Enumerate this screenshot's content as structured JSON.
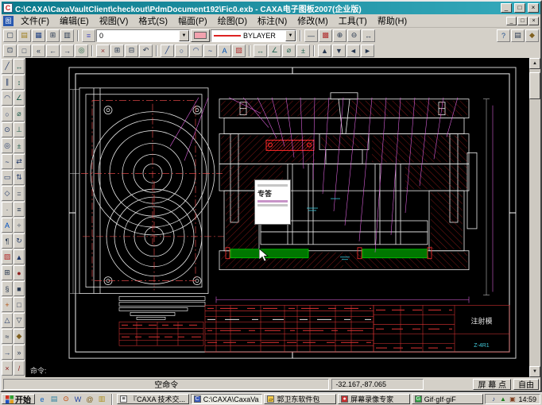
{
  "glyphs": {
    "arrow_down": "▼",
    "arrow_up": "▲"
  },
  "titlebar": {
    "title": "C:\\CAXA\\CaxaVaultClient\\checkout\\PdmDocument192\\Fic0.exb - CAXA电子图板2007(企业版)",
    "app_icon_glyph": "C",
    "min_glyph": "_",
    "max_glyph": "□",
    "close_glyph": "×"
  },
  "menubar": {
    "child_icon_glyph": "图",
    "items": [
      {
        "name": "menu-file",
        "label": "文件(F)"
      },
      {
        "name": "menu-edit",
        "label": "编辑(E)"
      },
      {
        "name": "menu-view",
        "label": "视图(V)"
      },
      {
        "name": "menu-format",
        "label": "格式(S)"
      },
      {
        "name": "menu-sheet",
        "label": "幅面(P)"
      },
      {
        "name": "menu-draw",
        "label": "绘图(D)"
      },
      {
        "name": "menu-dimension",
        "label": "标注(N)"
      },
      {
        "name": "menu-modify",
        "label": "修改(M)"
      },
      {
        "name": "menu-tools",
        "label": "工具(T)"
      },
      {
        "name": "menu-help",
        "label": "帮助(H)"
      }
    ],
    "child_min": "_",
    "child_restore": "□",
    "child_close": "×"
  },
  "toolbar1": {
    "file_group": [
      {
        "name": "new-file-icon",
        "glyph": "▢"
      },
      {
        "name": "open-file-icon",
        "glyph": "▤",
        "color": "#a08020"
      },
      {
        "name": "save-file-icon",
        "glyph": "▦",
        "color": "#204080"
      },
      {
        "name": "print-icon",
        "glyph": "⊞"
      },
      {
        "name": "preview-icon",
        "glyph": "▥"
      }
    ],
    "layers_icon": {
      "glyph": "≡",
      "color": "#5050c0"
    },
    "layer_value": "0",
    "color_value": "#f2a2ae",
    "linetype_value": "BYLAYER",
    "linetype_color": "#dd2222",
    "mid_group": [
      {
        "name": "linewidth-icon",
        "glyph": "—"
      },
      {
        "name": "color-palette-icon",
        "glyph": "▩",
        "color": "#b03030"
      },
      {
        "name": "zoom-in-icon",
        "glyph": "⊕"
      },
      {
        "name": "zoom-out-icon",
        "glyph": "⊖"
      },
      {
        "name": "pan-icon",
        "glyph": "↔"
      }
    ],
    "right_group": [
      {
        "name": "help-icon",
        "glyph": "?",
        "color": "#205090"
      },
      {
        "name": "properties-icon",
        "glyph": "▤"
      },
      {
        "name": "options-icon",
        "glyph": "◆",
        "color": "#806020"
      }
    ]
  },
  "toolbar2": {
    "g1": [
      {
        "name": "zoom-window-icon",
        "glyph": "⊡"
      },
      {
        "name": "zoom-all-icon",
        "glyph": "□"
      },
      {
        "name": "zoom-prev-icon",
        "glyph": "«"
      },
      {
        "name": "pan-left-icon",
        "glyph": "←"
      },
      {
        "name": "pan-right-icon",
        "glyph": "→"
      },
      {
        "name": "refresh-icon",
        "glyph": "◎",
        "color": "#206040"
      }
    ],
    "g2": [
      {
        "name": "cut-icon",
        "glyph": "×",
        "color": "#903030"
      },
      {
        "name": "copy-icon",
        "glyph": "⊞"
      },
      {
        "name": "paste-icon",
        "glyph": "⊟"
      },
      {
        "name": "undo-icon",
        "glyph": "↶"
      }
    ],
    "g3": [
      {
        "name": "draw-line-icon",
        "glyph": "╱",
        "color": "#204080"
      },
      {
        "name": "draw-circle-icon",
        "glyph": "○",
        "color": "#204080"
      },
      {
        "name": "draw-arc-icon",
        "glyph": "◠",
        "color": "#204080"
      },
      {
        "name": "draw-spline-icon",
        "glyph": "~",
        "color": "#204080"
      },
      {
        "name": "draw-text-icon",
        "glyph": "A",
        "color": "#0050b0"
      },
      {
        "name": "draw-hatch-icon",
        "glyph": "▨",
        "color": "#b03030"
      }
    ],
    "g4": [
      {
        "name": "dim-linear-icon",
        "glyph": "↔",
        "color": "#206050"
      },
      {
        "name": "dim-angle-icon",
        "glyph": "∠",
        "color": "#206050"
      },
      {
        "name": "dim-diameter-icon",
        "glyph": "⌀",
        "color": "#206050"
      },
      {
        "name": "dim-tolerance-icon",
        "glyph": "±",
        "color": "#206050"
      }
    ],
    "g5": [
      {
        "name": "layer-up-icon",
        "glyph": "▲"
      },
      {
        "name": "layer-down-icon",
        "glyph": "▼"
      },
      {
        "name": "prev-view-icon",
        "glyph": "◄"
      },
      {
        "name": "next-view-icon",
        "glyph": "►"
      }
    ]
  },
  "left_tools": {
    "col1": [
      {
        "name": "tool-line-icon",
        "glyph": "╱",
        "color": "#203868"
      },
      {
        "name": "tool-parallel-icon",
        "glyph": "∥",
        "color": "#203868"
      },
      {
        "name": "tool-arc-icon",
        "glyph": "◠",
        "color": "#203868"
      },
      {
        "name": "tool-circle-icon",
        "glyph": "○",
        "color": "#203868"
      },
      {
        "name": "tool-concentric-icon",
        "glyph": "⊙",
        "color": "#203868"
      },
      {
        "name": "tool-ellipse-icon",
        "glyph": "◎",
        "color": "#203868"
      },
      {
        "name": "tool-spline-icon",
        "glyph": "~",
        "color": "#203868"
      },
      {
        "name": "tool-rect-icon",
        "glyph": "▭",
        "color": "#203868"
      },
      {
        "name": "tool-polygon-icon",
        "glyph": "◇",
        "color": "#203868"
      },
      {
        "name": "tool-point-icon",
        "glyph": "·"
      },
      {
        "name": "tool-text-icon",
        "glyph": "A",
        "color": "#0050c0"
      },
      {
        "name": "tool-paragraph-icon",
        "glyph": "¶"
      },
      {
        "name": "tool-hatch-icon",
        "glyph": "▨",
        "color": "#b02828"
      },
      {
        "name": "tool-block-icon",
        "glyph": "⊞"
      },
      {
        "name": "tool-formula-icon",
        "glyph": "§"
      },
      {
        "name": "tool-axis-icon",
        "glyph": "+",
        "color": "#b05010"
      },
      {
        "name": "tool-contour-icon",
        "glyph": "△",
        "color": "#203868"
      },
      {
        "name": "tool-wave-icon",
        "glyph": "≈"
      },
      {
        "name": "tool-arrow-icon",
        "glyph": "→",
        "color": "#203868"
      },
      {
        "name": "tool-erase-icon",
        "glyph": "×",
        "color": "#902020"
      }
    ],
    "col2": [
      {
        "name": "dim-horizontal-icon",
        "glyph": "↔",
        "color": "#185848"
      },
      {
        "name": "dim-vertical-icon",
        "glyph": "↕",
        "color": "#185848"
      },
      {
        "name": "dim-angle2-icon",
        "glyph": "∠",
        "color": "#185848"
      },
      {
        "name": "dim-diameter2-icon",
        "glyph": "⌀",
        "color": "#185848"
      },
      {
        "name": "dim-perpendicular-icon",
        "glyph": "⊥",
        "color": "#185848"
      },
      {
        "name": "dim-tolerance2-icon",
        "glyph": "±",
        "color": "#185848"
      },
      {
        "name": "modify-mirror-icon",
        "glyph": "⇄",
        "color": "#203868"
      },
      {
        "name": "modify-array-icon",
        "glyph": "⇅",
        "color": "#203868"
      },
      {
        "name": "modify-equal-icon",
        "glyph": "="
      },
      {
        "name": "modify-offset-icon",
        "glyph": "≡"
      },
      {
        "name": "modify-divide-icon",
        "glyph": "÷"
      },
      {
        "name": "modify-rotate-icon",
        "glyph": "↻",
        "color": "#203868"
      },
      {
        "name": "modify-scale-icon",
        "glyph": "▲",
        "color": "#203868"
      },
      {
        "name": "modify-fill-icon",
        "glyph": "●",
        "color": "#902020"
      },
      {
        "name": "modify-solid-icon",
        "glyph": "■"
      },
      {
        "name": "modify-hollow-icon",
        "glyph": "□"
      },
      {
        "name": "modify-flip-icon",
        "glyph": "▽"
      },
      {
        "name": "modify-node-icon",
        "glyph": "◆",
        "color": "#806020"
      },
      {
        "name": "modify-next-icon",
        "glyph": "»"
      },
      {
        "name": "modify-trim-icon",
        "glyph": "/",
        "color": "#902020"
      }
    ]
  },
  "canvas": {
    "prompt": "命令:",
    "tooltip_text": "专答",
    "title_block_name": "注射模",
    "title_block_code": "Z-4R1"
  },
  "statusbar": {
    "command": "空命令",
    "coords": "-32.167,-87.065",
    "screen_point": "屏 幕 点",
    "pick_mode": "自由"
  },
  "taskbar": {
    "start_label": "开始",
    "quicklaunch": [
      {
        "name": "ie-icon",
        "glyph": "e",
        "color": "#1060c0"
      },
      {
        "name": "show-desktop-icon",
        "glyph": "▤",
        "color": "#3080a0"
      },
      {
        "name": "media-player-icon",
        "glyph": "⊙",
        "color": "#c04000"
      },
      {
        "name": "word-icon",
        "glyph": "W",
        "color": "#2040a0"
      },
      {
        "name": "mail-icon",
        "glyph": "@",
        "color": "#806020"
      },
      {
        "name": "folder-launch-icon",
        "glyph": "▥",
        "color": "#b09020"
      }
    ],
    "tasks": [
      {
        "label": "『CAXA 技术交...",
        "icon_glyph": "≡",
        "icon_bg": "#f0f0f0"
      },
      {
        "label": "C:\\CAXA\\CaxaVa...",
        "icon_glyph": "C",
        "icon_bg": "#3858b8"
      },
      {
        "label": "郭卫东软件包",
        "icon_glyph": "▱",
        "icon_bg": "#f0c84a"
      },
      {
        "label": "屏幕录像专家",
        "icon_glyph": "●",
        "icon_bg": "#c43030"
      },
      {
        "label": "Gif·gIf·giF",
        "icon_glyph": "G",
        "icon_bg": "#2e9e40"
      }
    ],
    "tray_icons": [
      {
        "name": "tray-volume-icon",
        "glyph": "♪",
        "color": "#204080"
      },
      {
        "name": "tray-shield-icon",
        "glyph": "▲",
        "color": "#208020"
      },
      {
        "name": "tray-display-icon",
        "glyph": "▣",
        "color": "#804020"
      }
    ],
    "clock": "14:59"
  }
}
